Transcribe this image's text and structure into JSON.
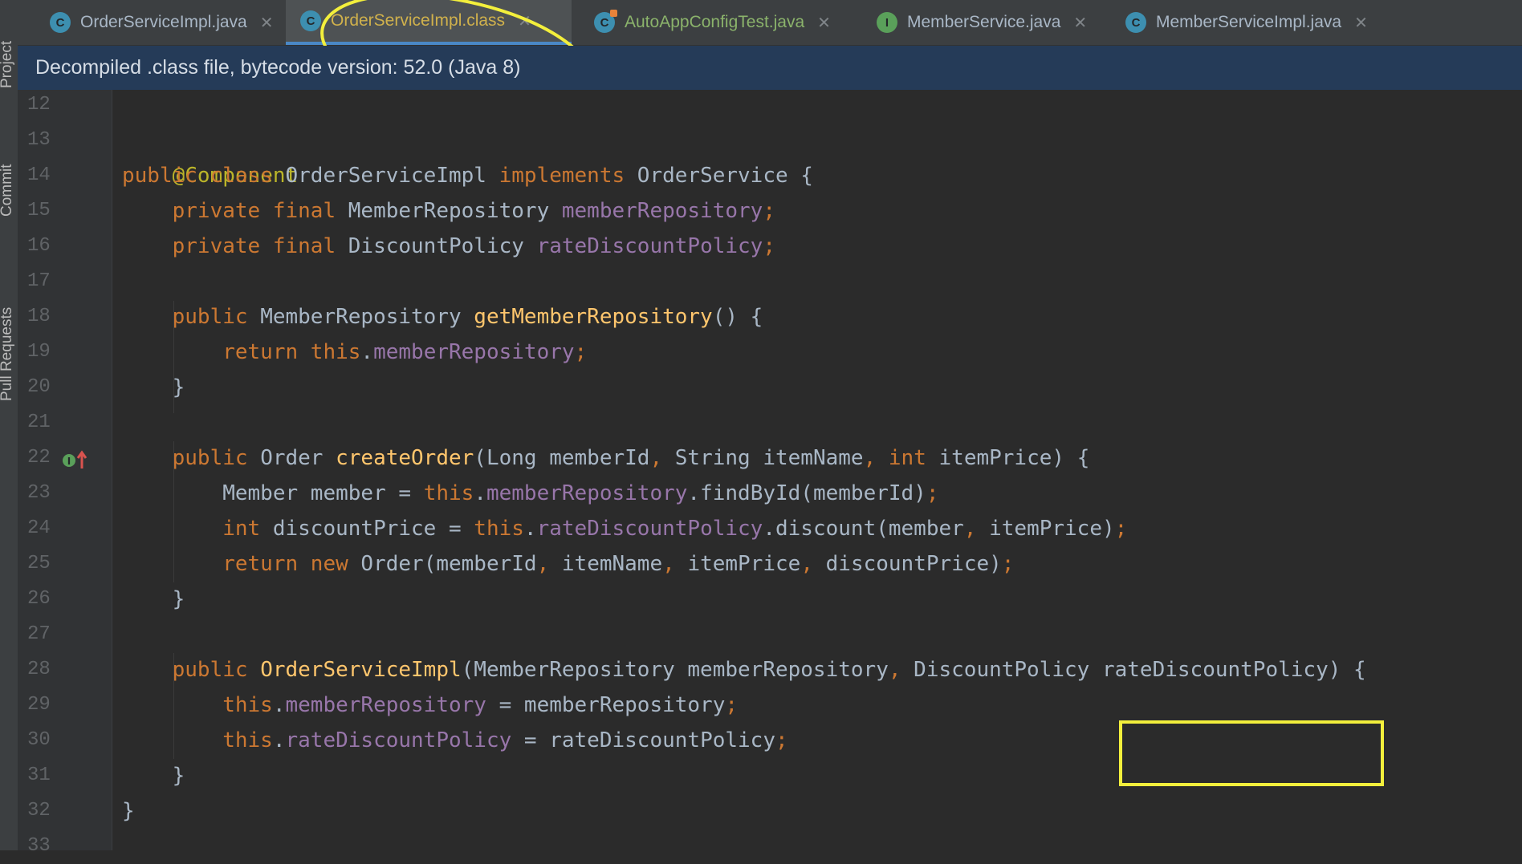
{
  "sidebar": {
    "tools": [
      {
        "label": "Project"
      },
      {
        "label": "Commit"
      },
      {
        "label": "Pull Requests"
      }
    ]
  },
  "tabs": [
    {
      "label": "OrderServiceImpl.java",
      "icon_letter": "C",
      "icon": "class-icon"
    },
    {
      "label": "OrderServiceImpl.class",
      "icon_letter": "C",
      "icon": "class-icon",
      "active": true
    },
    {
      "label": "AutoAppConfigTest.java",
      "icon_letter": "C",
      "icon": "test-class-icon"
    },
    {
      "label": "MemberService.java",
      "icon_letter": "I",
      "icon": "interface-icon"
    },
    {
      "label": "MemberServiceImpl.java",
      "icon_letter": "C",
      "icon": "class-icon"
    }
  ],
  "banner": {
    "text": "Decompiled .class file, bytecode version: 52.0 (Java 8)"
  },
  "editor": {
    "line_numbers": [
      "12",
      "13",
      "14",
      "15",
      "16",
      "17",
      "18",
      "19",
      "20",
      "21",
      "22",
      "23",
      "24",
      "25",
      "26",
      "27",
      "28",
      "29",
      "30",
      "31",
      "32",
      "33"
    ],
    "code": {
      "l13": "@Component",
      "l14": [
        "public class ",
        "OrderServiceImpl ",
        "implements ",
        "OrderService {"
      ],
      "l15": [
        "    private final ",
        "MemberRepository ",
        "memberRepository",
        ";"
      ],
      "l16": [
        "    private final ",
        "DiscountPolicy ",
        "rateDiscountPolicy",
        ";"
      ],
      "l18": [
        "    public ",
        "MemberRepository ",
        "getMemberRepository",
        "() {"
      ],
      "l19": [
        "        return this",
        ".",
        "memberRepository",
        ";"
      ],
      "l20": "    }",
      "l22": [
        "    public ",
        "Order ",
        "createOrder",
        "(Long memberId",
        ", ",
        "String itemName",
        ", ",
        "int ",
        "itemPrice) {"
      ],
      "l23": [
        "        Member member = ",
        "this",
        ".",
        "memberRepository",
        ".findById(memberId)",
        ";"
      ],
      "l24": [
        "        int ",
        "discountPrice = ",
        "this",
        ".",
        "rateDiscountPolicy",
        ".discount(member",
        ", ",
        "itemPrice)",
        ";"
      ],
      "l25": [
        "        return new ",
        "Order(memberId",
        ", ",
        "itemName",
        ", ",
        "itemPrice",
        ", ",
        "discountPrice)",
        ";"
      ],
      "l26": "    }",
      "l28": [
        "    public ",
        "OrderServiceImpl",
        "(MemberRepository memberRepository",
        ", ",
        "DiscountPolicy rateDiscountPolicy) {"
      ],
      "l29": [
        "        this",
        ".",
        "memberRepository",
        " = memberRepository",
        ";"
      ],
      "l30": [
        "        this",
        ".",
        "rateDiscountPolicy",
        " = rateDiscountPolicy",
        ";"
      ],
      "l31": "    }",
      "l32": "}"
    }
  },
  "colors": {
    "keyword": "#cc7832",
    "annotation": "#bbb529",
    "field": "#9876aa",
    "method": "#ffc66d",
    "text": "#a9b7c6",
    "highlight": "#f3ef3c",
    "banner_bg": "#253b58"
  }
}
